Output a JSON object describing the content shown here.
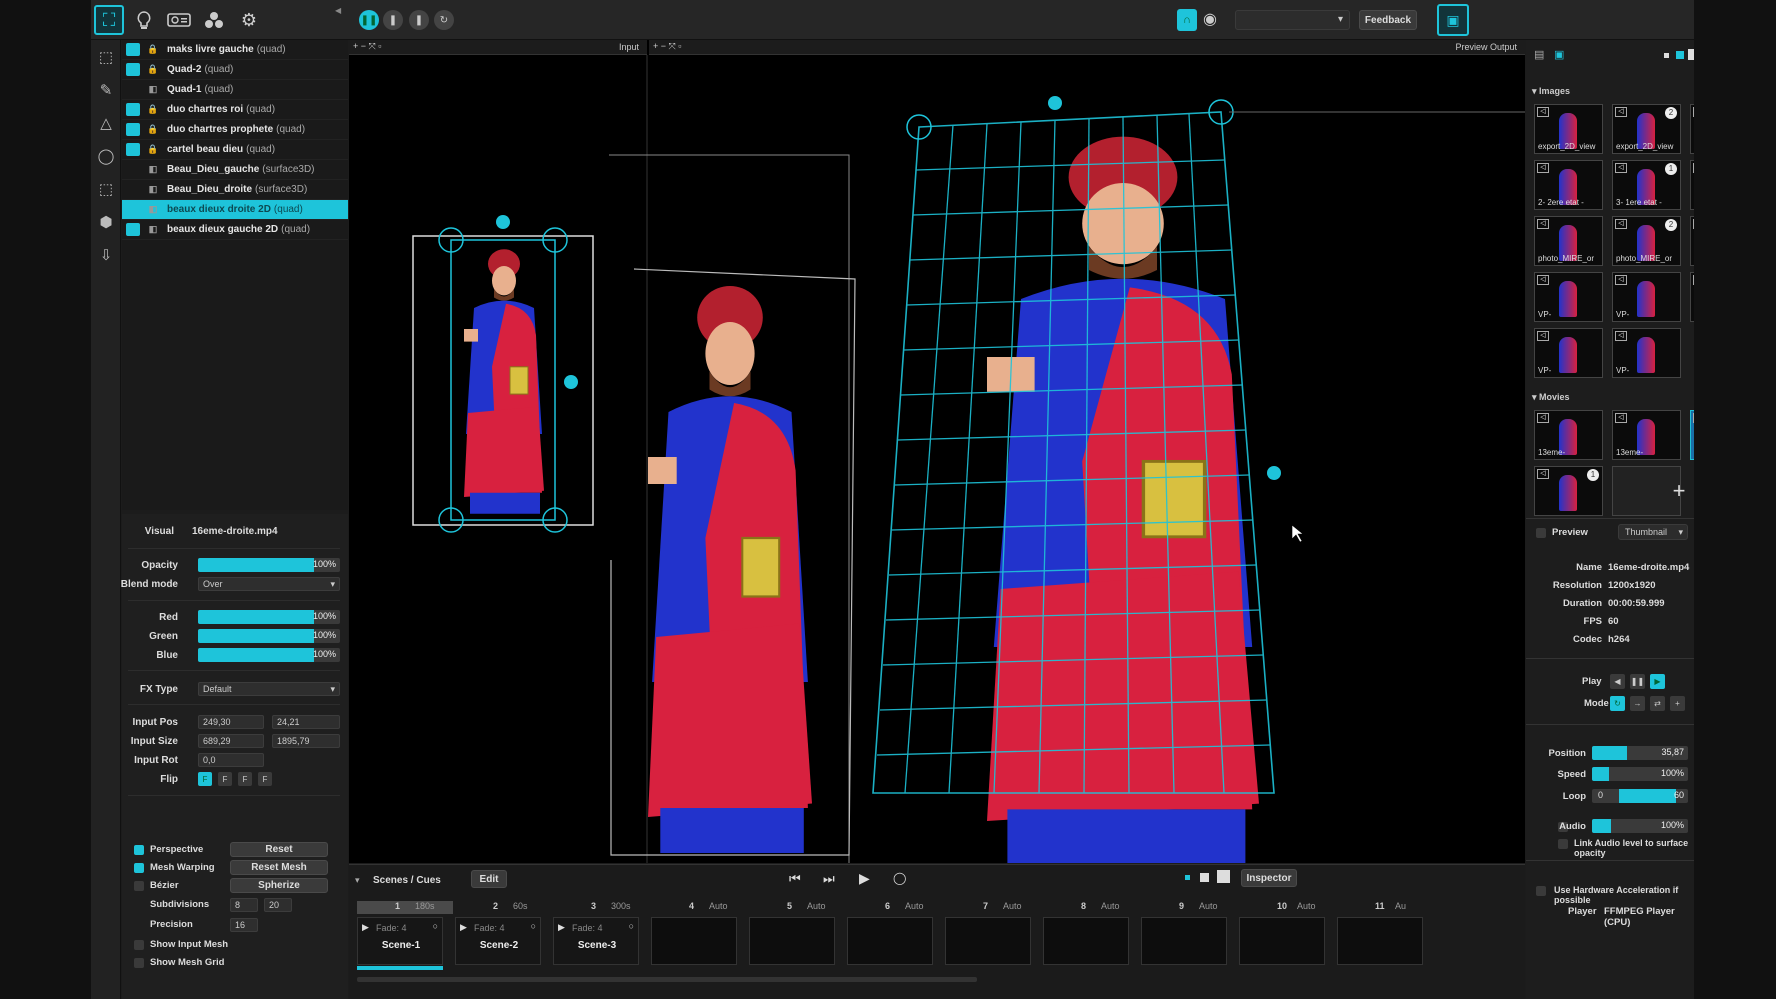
{
  "toolbar": {
    "icons": [
      "mapping-mode-icon",
      "lightbulb-icon",
      "projector-icon",
      "layers-icon",
      "gear-icon"
    ],
    "transport": [
      "pause-icon",
      "pause-icon",
      "pause-icon",
      "loop-icon"
    ],
    "feedback_label": "Feedback"
  },
  "layers": [
    {
      "name": "maks livre gauche",
      "type": "(quad)",
      "visible": true,
      "locked": true
    },
    {
      "name": "Quad-2",
      "type": "(quad)",
      "visible": true,
      "locked": true
    },
    {
      "name": "Quad-1",
      "type": "(quad)",
      "visible": false,
      "locked": false
    },
    {
      "name": "duo chartres roi",
      "type": "(quad)",
      "visible": true,
      "locked": true
    },
    {
      "name": "duo chartres prophete",
      "type": "(quad)",
      "visible": true,
      "locked": true
    },
    {
      "name": "cartel beau dieu",
      "type": "(quad)",
      "visible": true,
      "locked": true
    },
    {
      "name": "Beau_Dieu_gauche",
      "type": "(surface3D)",
      "visible": false,
      "locked": false
    },
    {
      "name": "Beau_Dieu_droite",
      "type": "(surface3D)",
      "visible": false,
      "locked": false
    },
    {
      "name": "beaux dieux droite 2D",
      "type": "(quad)",
      "visible": false,
      "locked": false,
      "selected": true
    },
    {
      "name": "beaux dieux gauche 2D",
      "type": "(quad)",
      "visible": true,
      "locked": false
    }
  ],
  "inspector": {
    "visual_label": "Visual",
    "visual_value": "16eme-droite.mp4",
    "opacity_label": "Opacity",
    "opacity_value": "100%",
    "blend_label": "Blend mode",
    "blend_value": "Over",
    "red_label": "Red",
    "red_value": "100%",
    "green_label": "Green",
    "green_value": "100%",
    "blue_label": "Blue",
    "blue_value": "100%",
    "fx_label": "FX Type",
    "fx_value": "Default",
    "input_pos_label": "Input Pos",
    "input_pos_x": "249,30",
    "input_pos_y": "24,21",
    "input_size_label": "Input Size",
    "input_size_w": "689,29",
    "input_size_h": "1895,79",
    "input_rot_label": "Input Rot",
    "input_rot_value": "0,0",
    "flip_label": "Flip",
    "perspective_label": "Perspective",
    "reset_label": "Reset",
    "mesh_warping_label": "Mesh Warping",
    "reset_mesh_label": "Reset Mesh",
    "bezier_label": "Bézier",
    "spherize_label": "Spherize",
    "subdivisions_label": "Subdivisions",
    "subdiv_x": "8",
    "subdiv_y": "20",
    "precision_label": "Precision",
    "precision_value": "16",
    "show_input_mesh_label": "Show Input Mesh",
    "show_mesh_grid_label": "Show Mesh Grid"
  },
  "viewport": {
    "input_label": "Input",
    "preview_output_label": "Preview Output"
  },
  "scenes": {
    "title": "Scenes / Cues",
    "edit_label": "Edit",
    "inspector_label": "Inspector",
    "ruler": [
      {
        "n": "1",
        "t": "180s"
      },
      {
        "n": "2",
        "t": "60s"
      },
      {
        "n": "3",
        "t": "300s"
      },
      {
        "n": "4",
        "t": "Auto"
      },
      {
        "n": "5",
        "t": "Auto"
      },
      {
        "n": "6",
        "t": "Auto"
      },
      {
        "n": "7",
        "t": "Auto"
      },
      {
        "n": "8",
        "t": "Auto"
      },
      {
        "n": "9",
        "t": "Auto"
      },
      {
        "n": "10",
        "t": "Auto"
      },
      {
        "n": "11",
        "t": "Au"
      }
    ],
    "cues": [
      {
        "fade": "Fade: 4",
        "name": "Scene-1"
      },
      {
        "fade": "Fade: 4",
        "name": "Scene-2"
      },
      {
        "fade": "Fade: 4",
        "name": "Scene-3"
      }
    ]
  },
  "media": {
    "images_label": "Images",
    "images": [
      {
        "cap": "export_2D_view",
        "badge": ""
      },
      {
        "cap": "export_2D_view",
        "badge": "2"
      },
      {
        "cap": "1- etat actuel",
        "badge": ""
      },
      {
        "cap": "2- 2ere etat -",
        "badge": ""
      },
      {
        "cap": "3- 1ere etat -",
        "badge": "1"
      },
      {
        "cap": "photo_MIRE_or",
        "badge": ""
      },
      {
        "cap": "photo_MIRE_or",
        "badge": ""
      },
      {
        "cap": "photo_MIRE_or",
        "badge": "2"
      },
      {
        "cap": "VP-",
        "badge": ""
      },
      {
        "cap": "VP-",
        "badge": ""
      },
      {
        "cap": "VP-",
        "badge": ""
      },
      {
        "cap": "VP-",
        "badge": ""
      },
      {
        "cap": "VP-",
        "badge": ""
      },
      {
        "cap": "VP-",
        "badge": ""
      }
    ],
    "movies_label": "Movies",
    "movies": [
      {
        "cap": "13eme-",
        "badge": ""
      },
      {
        "cap": "13eme-",
        "badge": ""
      },
      {
        "cap": "16eme-",
        "badge": "1"
      },
      {
        "cap": "",
        "badge": "1"
      }
    ],
    "preview_label": "Preview",
    "thumbnail_label": "Thumbnail",
    "props": [
      {
        "k": "Name",
        "v": "16eme-droite.mp4"
      },
      {
        "k": "Resolution",
        "v": "1200x1920"
      },
      {
        "k": "Duration",
        "v": "00:00:59.999"
      },
      {
        "k": "FPS",
        "v": "60"
      },
      {
        "k": "Codec",
        "v": "h264"
      }
    ],
    "play_label": "Play",
    "mode_label": "Mode",
    "position_label": "Position",
    "position_value": "35,87",
    "speed_label": "Speed",
    "speed_value": "100%",
    "loop_label": "Loop",
    "loop_start": "0",
    "loop_end": "60",
    "audio_label": "Audio",
    "audio_value": "100%",
    "link_audio_label": "Link Audio level to surface opacity",
    "hw_accel_label": "Use Hardware Acceleration if possible",
    "player_label": "Player",
    "player_value": "FFMPEG Player (CPU)"
  },
  "colors": {
    "accent": "#1ec4da",
    "panel": "#1c1c1c",
    "robe_blue": "#2233cc",
    "robe_red": "#d8213f"
  }
}
